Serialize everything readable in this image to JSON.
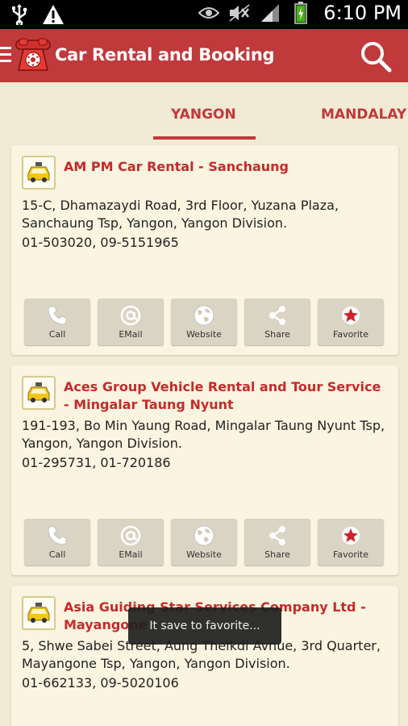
{
  "status_bar": {
    "time": "6:10 PM",
    "icons": [
      "usb-icon",
      "warning-icon",
      "eye-icon",
      "mute-icon",
      "signal-icon",
      "battery-icon"
    ]
  },
  "action_bar": {
    "title": "Car Rental and Booking",
    "logo_icon": "telephone-icon",
    "search_icon": "search-icon",
    "accent_color": "#c0393b"
  },
  "tabs": [
    {
      "label": "YANGON",
      "selected": true
    },
    {
      "label": "MANDALAY",
      "selected": false
    }
  ],
  "button_labels": {
    "call": "Call",
    "email": "EMail",
    "website": "Website",
    "share": "Share",
    "favorite": "Favorite"
  },
  "listings": [
    {
      "name": "AM PM Car Rental - Sanchaung",
      "address": "15-C, Dhamazaydi Road, 3rd Floor, Yuzana Plaza, Sanchaung Tsp, Yangon, Yangon Division.",
      "phone": "01-503020, 09-5151965"
    },
    {
      "name": "Aces Group Vehicle Rental and Tour Service - Mingalar Taung Nyunt",
      "address": "191-193, Bo Min Yaung Road, Mingalar Taung Nyunt Tsp, Yangon, Yangon Division.",
      "phone": "01-295731, 01-720186"
    },
    {
      "name": "Asia Guiding Star Services Company Ltd - Mayangone",
      "address": "5, Shwe Sabei Street, Aung Theikdi Avnue, 3rd Quarter, Mayangone Tsp, Yangon, Yangon Division.",
      "phone": "01-662133, 09-5020106"
    }
  ],
  "toast": {
    "message": "It save to favorite..."
  }
}
